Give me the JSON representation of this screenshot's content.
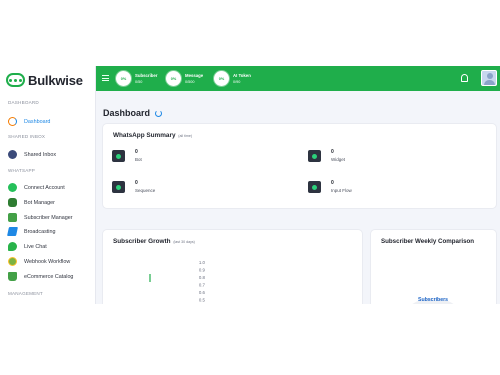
{
  "brand": {
    "name": "Bulkwise"
  },
  "sidebar": {
    "sections": [
      {
        "label": "DASHBOARD"
      },
      {
        "label": "SHARED INBOX"
      },
      {
        "label": "WHATSAPP"
      },
      {
        "label": "MANAGEMENT"
      }
    ],
    "items": [
      {
        "label": "Dashboard",
        "icon": "dashboard-icon"
      },
      {
        "label": "Shared Inbox",
        "icon": "shared-inbox-icon"
      },
      {
        "label": "Connect Account",
        "icon": "whatsapp-icon"
      },
      {
        "label": "Bot Manager",
        "icon": "bot-icon"
      },
      {
        "label": "Subscriber Manager",
        "icon": "subscriber-icon"
      },
      {
        "label": "Broadcasting",
        "icon": "broadcast-icon"
      },
      {
        "label": "Live Chat",
        "icon": "live-chat-icon"
      },
      {
        "label": "Webhook Workflow",
        "icon": "webhook-icon"
      },
      {
        "label": "eCommerce Catalog",
        "icon": "catalog-icon"
      }
    ]
  },
  "topbar": {
    "stats": [
      {
        "percent": "0%",
        "title": "Subscriber",
        "value": "0/50"
      },
      {
        "percent": "0%",
        "title": "Message",
        "value": "0/500"
      },
      {
        "percent": "0%",
        "title": "AI Token",
        "value": "0/90"
      }
    ],
    "icons": {
      "menu": "menu-icon",
      "notification": "bell-icon",
      "avatar": "user-avatar"
    }
  },
  "main": {
    "title": "Dashboard",
    "summary": {
      "title": "WhatsApp Summary",
      "subtitle": "(all time)",
      "items": [
        {
          "value": "0",
          "label": "Bot"
        },
        {
          "value": "0",
          "label": "Widget"
        },
        {
          "value": "0",
          "label": "Sequence"
        },
        {
          "value": "0",
          "label": "Input Flow"
        }
      ]
    },
    "growth": {
      "title": "Subscriber Growth",
      "subtitle": "(last 30 days)"
    },
    "weekly": {
      "title": "Subscriber Weekly Comparison",
      "center_label": "Subscribers"
    }
  },
  "chart_data": {
    "type": "line",
    "title": "Subscriber Growth",
    "subtitle": "(last 30 days)",
    "y_ticks": [
      "1.0",
      "0.9",
      "0.8",
      "0.7",
      "0.6",
      "0.5"
    ],
    "ylim": [
      0,
      1
    ],
    "series": [],
    "accent": "#1fae4b"
  },
  "colors": {
    "brand": "#1fae4b",
    "accent": "#1e88e5",
    "text": "#23262f"
  }
}
